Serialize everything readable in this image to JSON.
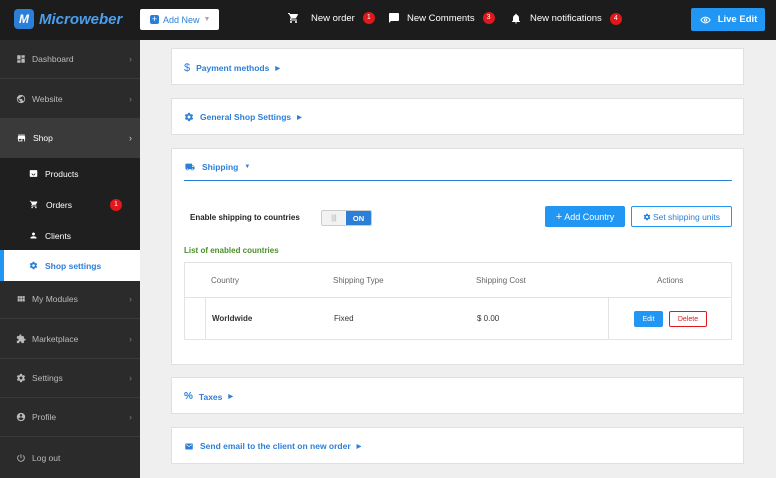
{
  "app": {
    "name": "Microweber"
  },
  "topbar": {
    "add_new": "Add New",
    "new_order": {
      "label": "New order",
      "count": "1"
    },
    "new_comments": {
      "label": "New Comments",
      "count": "3"
    },
    "new_notifications": {
      "label": "New notifications",
      "count": "4"
    },
    "live_edit": "Live Edit"
  },
  "sidebar": {
    "dashboard": "Dashboard",
    "website": "Website",
    "shop": "Shop",
    "products": "Products",
    "orders": "Orders",
    "orders_count": "1",
    "clients": "Clients",
    "shop_settings": "Shop settings",
    "my_modules": "My Modules",
    "marketplace": "Marketplace",
    "settings": "Settings",
    "profile": "Profile",
    "logout": "Log out"
  },
  "panels": {
    "payment": "Payment methods",
    "general": "General Shop Settings",
    "shipping": "Shipping",
    "taxes": "Taxes",
    "email": "Send email to the client on new order"
  },
  "shipping": {
    "enable_label": "Enable shipping to countries",
    "toggle_off": "|||",
    "toggle_on": "ON",
    "add_country": "Add Country",
    "set_units": "Set shipping units",
    "list_title": "List of enabled countries",
    "columns": [
      "Country",
      "Shipping Type",
      "Shipping Cost",
      "Actions"
    ],
    "rows": [
      {
        "country": "Worldwide",
        "type": "Fixed",
        "cost": "$ 0.00"
      }
    ],
    "edit": "Edit",
    "delete": "Delete"
  }
}
